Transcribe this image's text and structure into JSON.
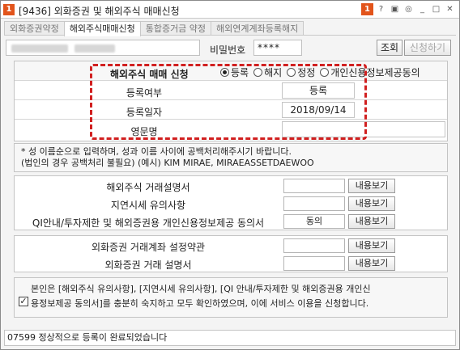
{
  "window": {
    "badge": "1",
    "title": "[9436] 외화증권 및 해외주식 매매신청",
    "icons": [
      "help-icon",
      "form-icon",
      "camera-icon",
      "settings-icon",
      "minimize-icon",
      "maximize-icon",
      "close-icon"
    ],
    "icon_glyphs": [
      "1",
      "?",
      "▣",
      "◎",
      "_",
      "□",
      "✕"
    ]
  },
  "tabs": [
    {
      "label": "외화증권약정",
      "active": false
    },
    {
      "label": "해외주식매매신청",
      "active": true
    },
    {
      "label": "통합증거금 약정",
      "active": false
    },
    {
      "label": "해외연계계좌등록해지",
      "active": false
    }
  ],
  "account": {
    "password_label": "비밀번호",
    "password_value": "****",
    "query_button": "조회",
    "apply_button": "신청하기"
  },
  "registration": {
    "title": "해외주식 매매 신청",
    "options": [
      {
        "label": "등록",
        "selected": true
      },
      {
        "label": "해지",
        "selected": false
      },
      {
        "label": "정정",
        "selected": false
      },
      {
        "label": "개인신용정보제공동의",
        "selected": false
      }
    ],
    "rows": [
      {
        "label": "등록여부",
        "value": "등록"
      },
      {
        "label": "등록일자",
        "value": "2018/09/14"
      },
      {
        "label": "영문명",
        "value": ""
      }
    ]
  },
  "note": {
    "line1": "* 성 이름순으로 입력하며, 성과 이름 사이에 공백처리해주시기 바랍니다.",
    "line2": "(법인의 경우 공백처리 불필요) (예시) KIM MIRAE, MIRAEASSETDAEWOO"
  },
  "docs_group1": [
    {
      "label": "해외주식 거래설명서",
      "value": "",
      "button": "내용보기"
    },
    {
      "label": "지연시세 유의사항",
      "value": "",
      "button": "내용보기"
    },
    {
      "label": "QI안내/투자제한 및 해외증권용 개인신용정보제공 동의서",
      "value": "동의",
      "button": "내용보기"
    }
  ],
  "docs_group2": [
    {
      "label": "외화증권 거래계좌 설정약관",
      "value": "",
      "button": "내용보기"
    },
    {
      "label": "외화증권 거래 설명서",
      "value": "",
      "button": "내용보기"
    }
  ],
  "agreement": {
    "checked": true,
    "line1": "본인은 [해외주식 유의사항], [지연시세 유의사항], [QI 안내/투자제한 및 해외증권용 개인신",
    "line2": "용정보제공 동의서]를 충분히 숙지하고 모두 확인하였으며, 이에 서비스 이용을 신청합니다."
  },
  "status": {
    "message": "07599 정상적으로 등록이 완료되었습니다"
  }
}
